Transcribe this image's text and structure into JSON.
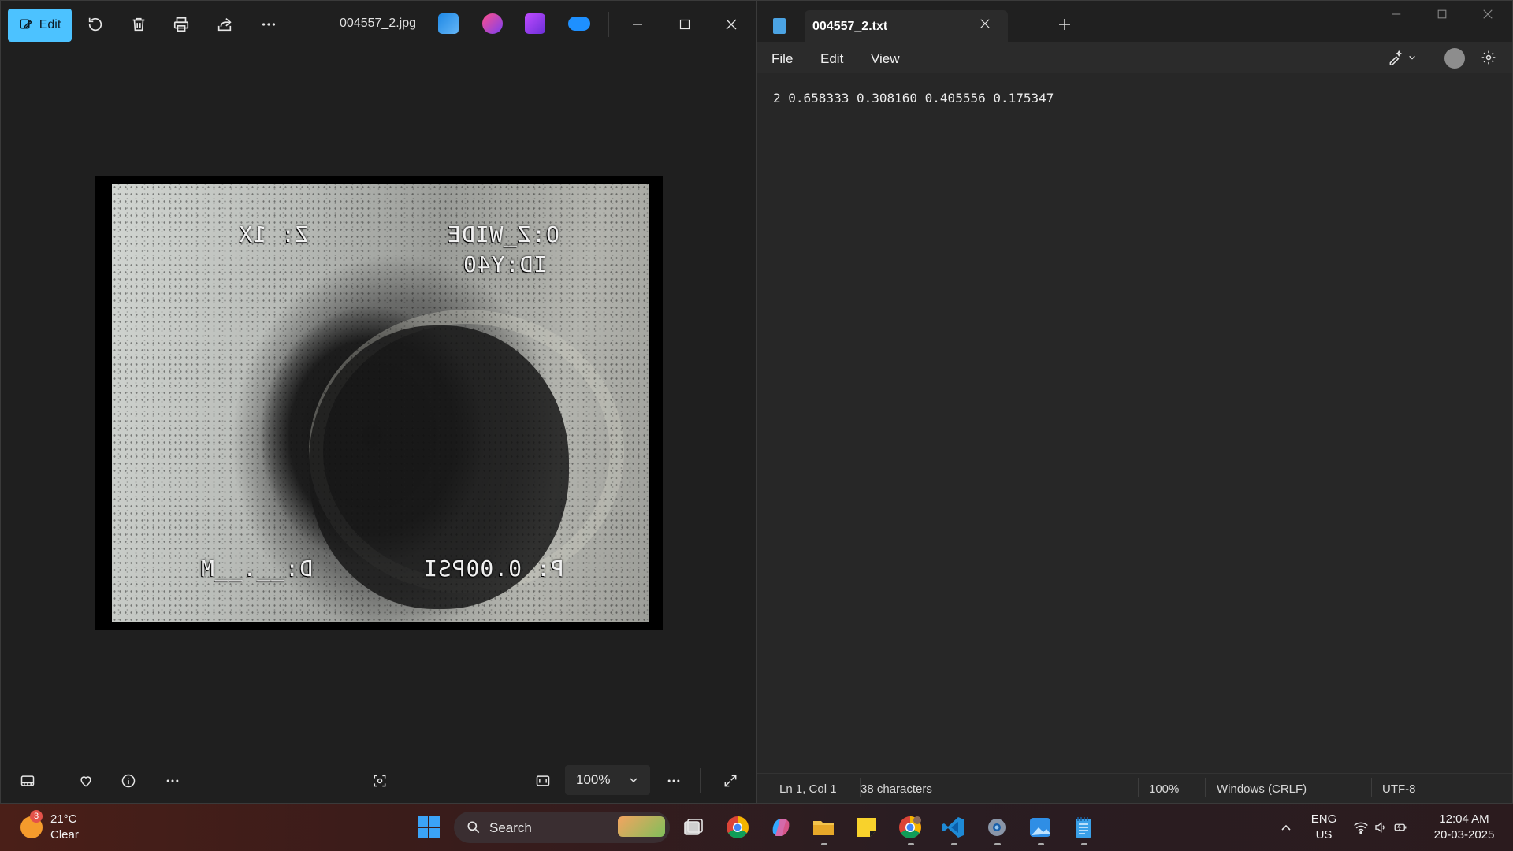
{
  "photos": {
    "edit_label": "Edit",
    "filename": "004557_2.jpg",
    "zoom": "100%",
    "osd": {
      "top_right": "O:Z_WIDE",
      "top_left": "Z:   1X",
      "id_line": "ID:Y40",
      "bottom_right": "P: 0.00PSI",
      "bottom_left": "D:__.__M"
    },
    "icons": {
      "rotate": "rotate-icon",
      "delete": "trash-icon",
      "print": "print-icon",
      "share": "share-icon",
      "more": "more-icon",
      "filmstrip": "filmstrip-icon",
      "favorite": "heart-icon",
      "info": "info-icon",
      "visual_search": "visual-search-icon",
      "fit": "fit-window-icon",
      "fullscreen": "fullscreen-icon"
    }
  },
  "notepad": {
    "tab_title": "004557_2.txt",
    "menu": [
      "File",
      "Edit",
      "View"
    ],
    "content": "2 0.658333 0.308160 0.405556 0.175347",
    "status": {
      "position": "Ln 1, Col 1",
      "chars": "38 characters",
      "zoom": "100%",
      "line_ending": "Windows (CRLF)",
      "encoding": "UTF-8"
    }
  },
  "taskbar": {
    "weather": {
      "temp": "21°C",
      "condition": "Clear",
      "badge": "3"
    },
    "search_placeholder": "Search",
    "tray": {
      "lang": "ENG",
      "region": "US",
      "time": "12:04 AM",
      "date": "20-03-2025"
    }
  },
  "colors": {
    "accent": "#4cc2ff",
    "window_bg": "#1f1f1f",
    "notepad_bg": "#272727"
  }
}
